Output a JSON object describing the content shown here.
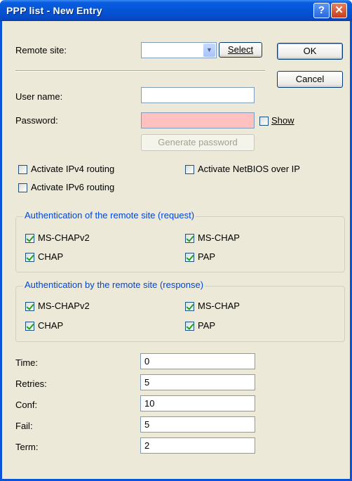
{
  "window": {
    "title": "PPP list - New Entry",
    "help_button": "?",
    "close_button": "✕"
  },
  "buttons": {
    "ok": "OK",
    "cancel": "Cancel",
    "select": "Select",
    "generate_password": "Generate password"
  },
  "remote_site": {
    "label": "Remote site:",
    "value": ""
  },
  "user_name": {
    "label": "User name:",
    "value": ""
  },
  "password": {
    "label": "Password:",
    "value": "",
    "show_label": "Show",
    "show_checked": false
  },
  "routing": {
    "ipv4": {
      "label": "Activate IPv4 routing",
      "checked": false
    },
    "ipv6": {
      "label": "Activate IPv6 routing",
      "checked": false
    },
    "netbios": {
      "label": "Activate NetBIOS over IP",
      "checked": false
    }
  },
  "auth_request": {
    "title": "Authentication of the remote site (request)",
    "ms_chapv2": {
      "label": "MS-CHAPv2",
      "checked": true
    },
    "ms_chap": {
      "label": "MS-CHAP",
      "checked": true
    },
    "chap": {
      "label": "CHAP",
      "checked": true
    },
    "pap": {
      "label": "PAP",
      "checked": true
    }
  },
  "auth_response": {
    "title": "Authentication by the remote site (response)",
    "ms_chapv2": {
      "label": "MS-CHAPv2",
      "checked": true
    },
    "ms_chap": {
      "label": "MS-CHAP",
      "checked": true
    },
    "chap": {
      "label": "CHAP",
      "checked": true
    },
    "pap": {
      "label": "PAP",
      "checked": true
    }
  },
  "fields": {
    "time": {
      "label": "Time:",
      "value": "0"
    },
    "retries": {
      "label": "Retries:",
      "value": "5"
    },
    "conf": {
      "label": "Conf:",
      "value": "10"
    },
    "fail": {
      "label": "Fail:",
      "value": "5"
    },
    "term": {
      "label": "Term:",
      "value": "2"
    }
  }
}
